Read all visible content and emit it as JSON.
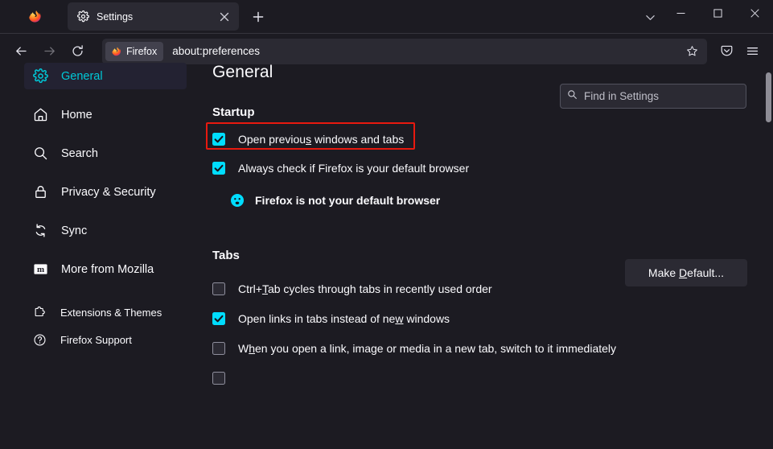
{
  "window": {
    "controls": {
      "list_all_tabs": "list-all-tabs",
      "minimize": "minimize",
      "maximize": "maximize",
      "close": "close"
    }
  },
  "tabbar": {
    "tabs": [
      {
        "title": "Settings",
        "icon": "gear-icon",
        "active": true,
        "close_label": "Close tab"
      }
    ],
    "new_tab_label": "Open a new tab"
  },
  "navbar": {
    "back_label": "Go back one page",
    "forward_label": "Go forward one page",
    "reload_label": "Reload current page",
    "identity_label": "Firefox",
    "url": "about:preferences",
    "bookmark_label": "Bookmark this page",
    "pocket_label": "Save to Pocket",
    "menu_label": "Open application menu"
  },
  "search": {
    "placeholder": "Find in Settings",
    "value": "",
    "icon": "search-icon"
  },
  "sidebar": {
    "items": [
      {
        "label": "General",
        "icon": "gear-icon",
        "selected": true
      },
      {
        "label": "Home",
        "icon": "home-icon",
        "selected": false
      },
      {
        "label": "Search",
        "icon": "search-icon",
        "selected": false
      },
      {
        "label": "Privacy & Security",
        "icon": "lock-icon",
        "selected": false
      },
      {
        "label": "Sync",
        "icon": "sync-icon",
        "selected": false
      },
      {
        "label": "More from Mozilla",
        "icon": "mozilla-m-icon",
        "selected": false
      }
    ],
    "footer_items": [
      {
        "label": "Extensions & Themes",
        "icon": "puzzle-piece-icon"
      },
      {
        "label": "Firefox Support",
        "icon": "question-circle-icon"
      }
    ]
  },
  "main": {
    "page_title": "General",
    "sections": [
      {
        "heading": "Startup",
        "options": [
          {
            "label_before": "Open previou",
            "accesskey": "s",
            "label_after": " windows and tabs",
            "checked": true,
            "highlighted": true
          },
          {
            "label_before": "Always check if Firefox is your default browser",
            "accesskey": "",
            "label_after": "",
            "checked": true,
            "highlighted": false
          }
        ]
      },
      {
        "heading": "Tabs",
        "options": [
          {
            "label_before": "Ctrl+",
            "accesskey": "T",
            "label_after": "ab cycles through tabs in recently used order",
            "checked": false,
            "highlighted": false
          },
          {
            "label_before": "Open links in tabs instead of ne",
            "accesskey": "w",
            "label_after": " windows",
            "checked": true,
            "highlighted": false
          },
          {
            "label_before": "W",
            "accesskey": "h",
            "label_after": "en you open a link, image or media in a new tab, switch to it immediately",
            "checked": false,
            "highlighted": false
          }
        ]
      }
    ],
    "default_browser_notice": {
      "icon": "info-circle-icon",
      "text": "Firefox is not your default browser"
    },
    "make_default_button": {
      "label_before": "Make ",
      "accesskey": "D",
      "label_after": "efault..."
    }
  },
  "colors": {
    "accent": "#00ddff",
    "selected_text": "#00c8d7",
    "highlight_box": "#e8190f",
    "background": "#1c1b22",
    "surface": "#2b2a33",
    "text": "#fbfbfe"
  }
}
